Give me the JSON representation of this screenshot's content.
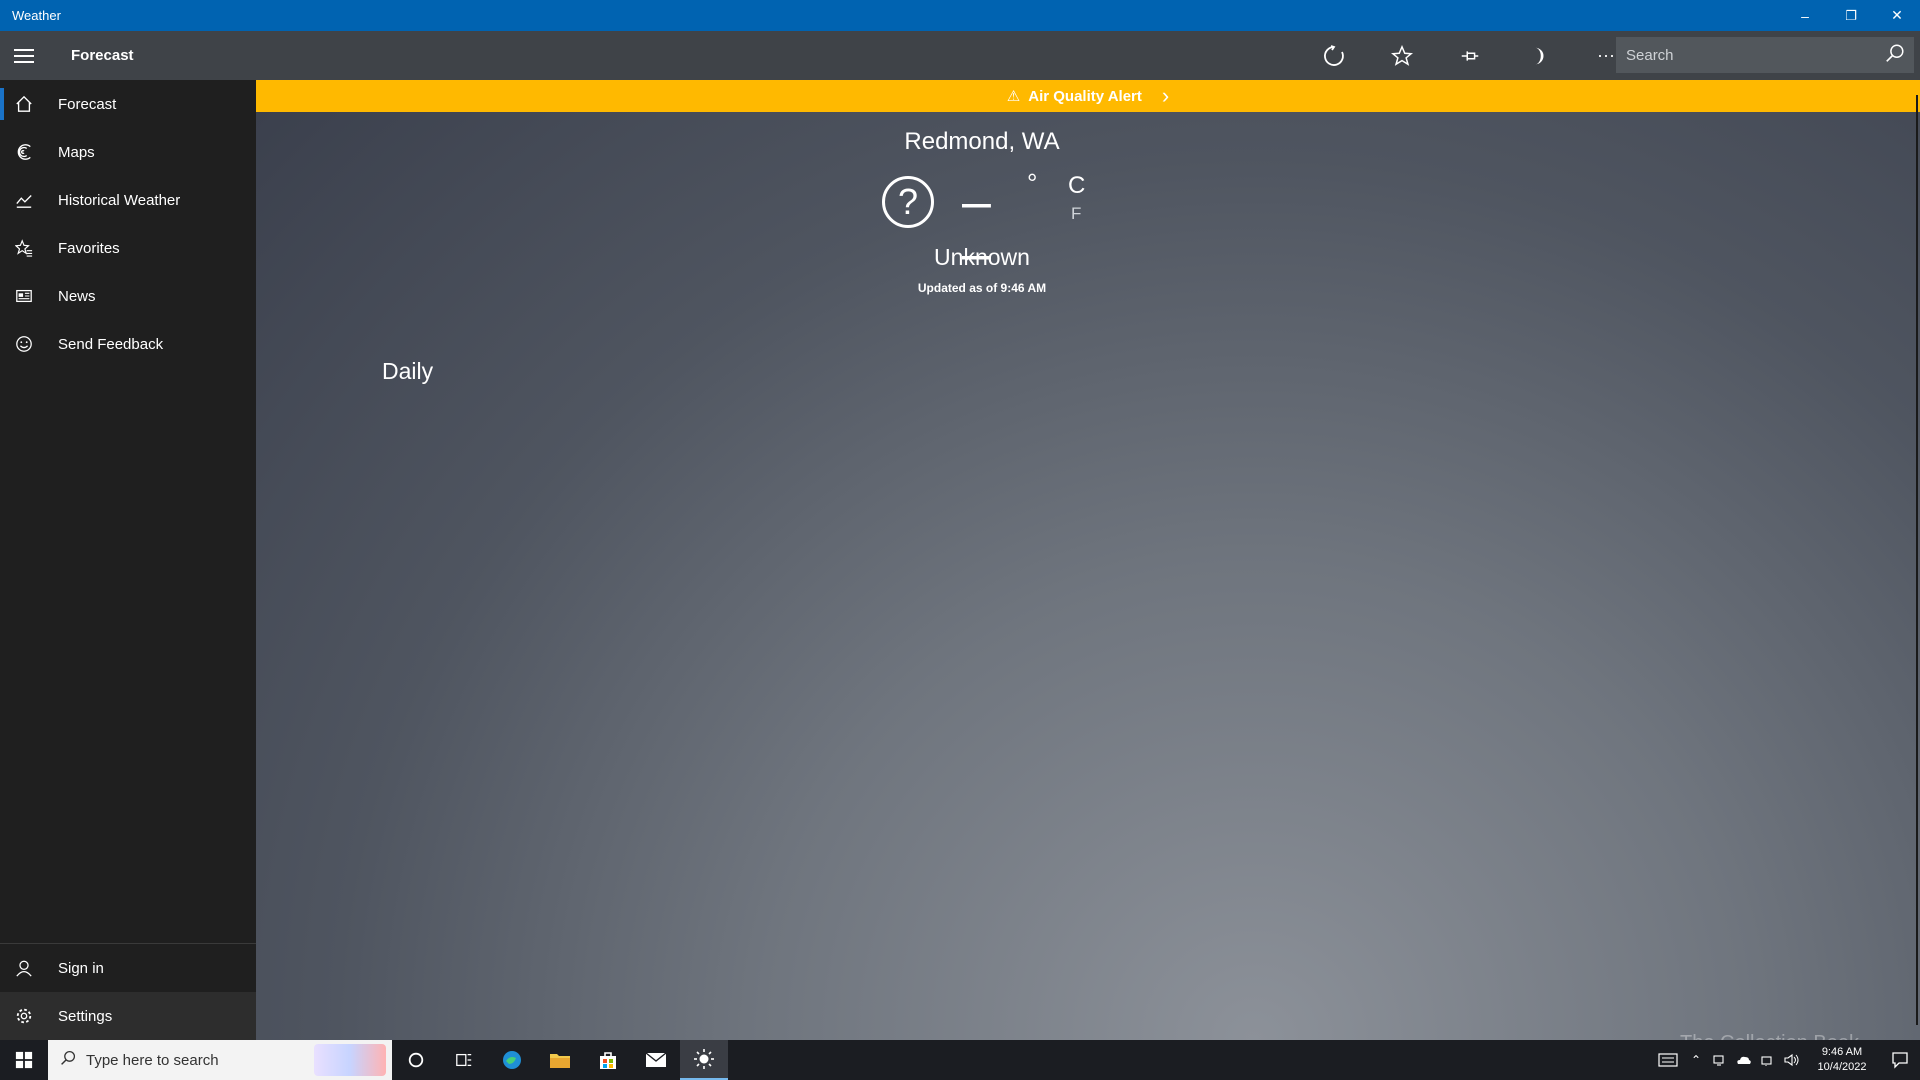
{
  "window": {
    "title": "Weather",
    "minimize": "–",
    "restore": "❐",
    "close": "✕"
  },
  "commandbar": {
    "title": "Forecast",
    "search_placeholder": "Search"
  },
  "sidebar": {
    "items": [
      {
        "label": "Forecast",
        "icon": "home-icon"
      },
      {
        "label": "Maps",
        "icon": "map-icon"
      },
      {
        "label": "Historical Weather",
        "icon": "chart-icon"
      },
      {
        "label": "Favorites",
        "icon": "favorites-icon"
      },
      {
        "label": "News",
        "icon": "news-icon"
      },
      {
        "label": "Send Feedback",
        "icon": "feedback-icon"
      }
    ],
    "bottom": [
      {
        "label": "Sign in",
        "icon": "person-icon"
      },
      {
        "label": "Settings",
        "icon": "gear-icon"
      }
    ]
  },
  "alert": {
    "label": "Air Quality Alert",
    "icon": "⚠",
    "chevron": "›"
  },
  "current": {
    "location": "Redmond, WA",
    "condition_icon": "?",
    "temperature": "– –",
    "degree": "°",
    "unit_c": "C",
    "unit_f": "F",
    "condition": "Unknown",
    "updated": "Updated as of 9:46 AM"
  },
  "section": {
    "daily": "Daily"
  },
  "taskbar": {
    "search_placeholder": "Type here to search",
    "clock_time": "9:46 AM",
    "clock_date": "10/4/2022"
  },
  "watermark": "The Collection Book",
  "colors": {
    "titlebar": "#0063b1",
    "alert": "#ffb900",
    "sidebar": "#1f1f1f",
    "selected_accent": "#1a73c8"
  }
}
